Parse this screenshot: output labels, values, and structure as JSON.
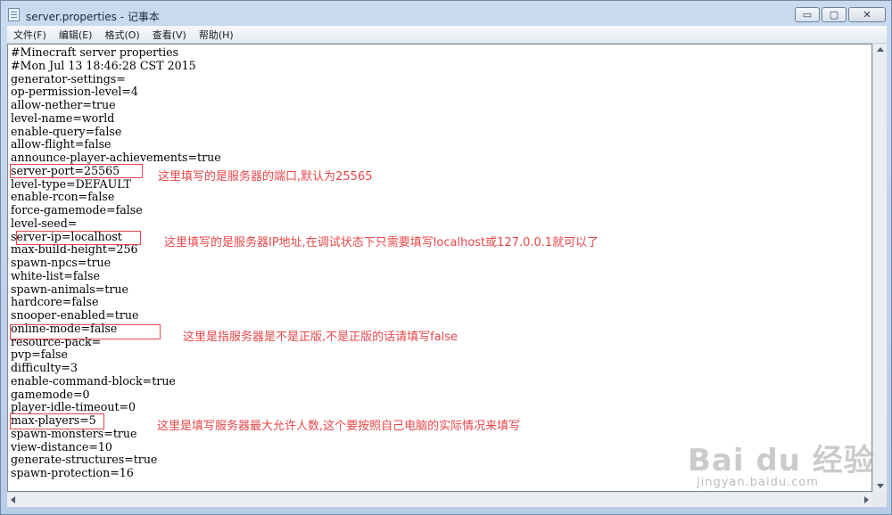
{
  "window": {
    "title": "server.properties - 记事本",
    "buttons": {
      "minimize": "▭",
      "maximize": "▢",
      "close": "✕"
    }
  },
  "menu": [
    "文件(F)",
    "编辑(E)",
    "格式(O)",
    "查看(V)",
    "帮助(H)"
  ],
  "lines": [
    "#Minecraft server properties",
    "#Mon Jul 13 18:46:28 CST 2015",
    "generator-settings=",
    "op-permission-level=4",
    "allow-nether=true",
    "level-name=world",
    "enable-query=false",
    "allow-flight=false",
    "announce-player-achievements=true",
    "server-port=25565",
    "level-type=DEFAULT",
    "enable-rcon=false",
    "force-gamemode=false",
    "level-seed=",
    "server-ip=localhost",
    "max-build-height=256",
    "spawn-npcs=true",
    "white-list=false",
    "spawn-animals=true",
    "hardcore=false",
    "snooper-enabled=true",
    "online-mode=false",
    "resource-pack=",
    "pvp=false",
    "difficulty=3",
    "enable-command-block=true",
    "gamemode=0",
    "player-idle-timeout=0",
    "max-players=5",
    "spawn-monsters=true",
    "view-distance=10",
    "generate-structures=true",
    "spawn-protection=16"
  ],
  "annotations": {
    "port": "这里填写的是服务器的端口,默认为25565",
    "ip": "这里填写的是服务器IP地址,在调试状态下只需要填写localhost或127.0.0.1就可以了",
    "online": "这里是指服务器是不是正版,不是正版的话请填写false",
    "players": "这里是填写服务器最大允许人数,这个要按照自己电脑的实际情况来填写"
  },
  "watermark": {
    "logo": "Bai du 经验",
    "url": "jingyan.baidu.com"
  },
  "colors": {
    "annotation": "#e8474a"
  }
}
